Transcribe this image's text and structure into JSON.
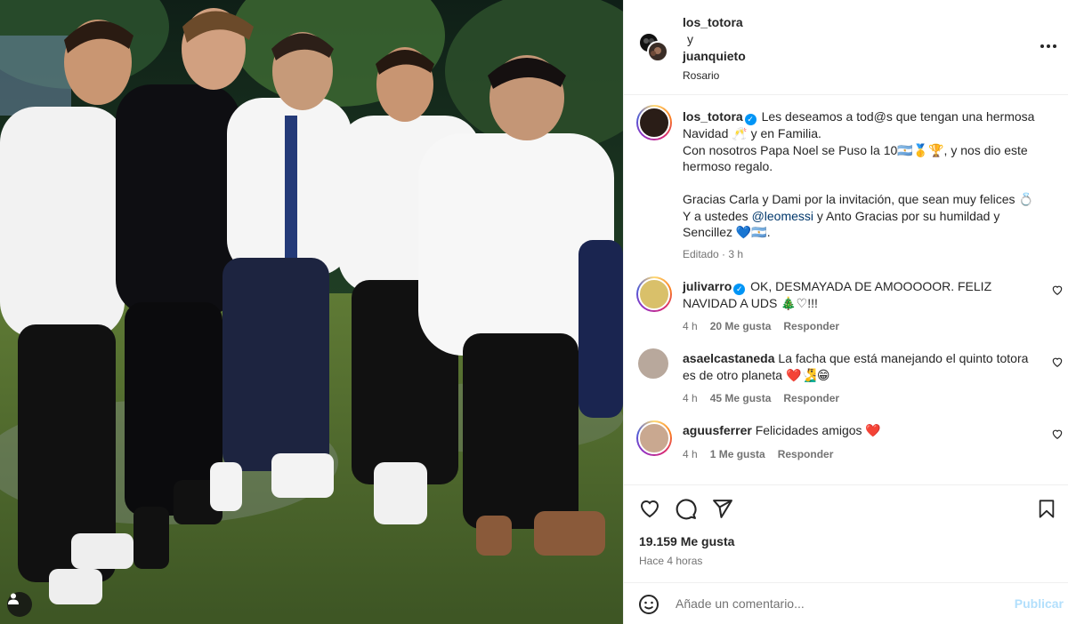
{
  "post": {
    "authors": [
      "los_totora",
      "juanquieto"
    ],
    "joiner": "y",
    "location": "Rosario",
    "caption": {
      "username": "los_totora",
      "line1": "Les deseamos a tod@s que tengan una hermosa Navidad 🥂 y en Familia.",
      "line2": "Con nosotros Papa Noel se Puso la 10🇦🇷🥇🏆, y nos dio este hermoso regalo.",
      "line3_a": "Gracias Carla y Dami por la invitación, que sean muy felices 💍 Y a ustedes",
      "mention": "@leomessi",
      "line3_b": "y Anto Gracias por su humildad y Sencillez 💙🇦🇷.",
      "edited": "Editado · 3 h"
    },
    "likes": "19.159 Me gusta",
    "time_ago": "Hace 4 horas"
  },
  "comments": [
    {
      "username": "julivarro",
      "verified": true,
      "text": "OK, DESMAYADA DE AMOOOOOR. FELIZ NAVIDAD A UDS 🎄♡!!!",
      "time": "4 h",
      "likes": "20 Me gusta",
      "reply": "Responder"
    },
    {
      "username": "asaelcastaneda",
      "verified": false,
      "text": "La facha que está manejando el quinto totora es de otro planeta ❤️🧏‍♂️😁",
      "time": "4 h",
      "likes": "45 Me gusta",
      "reply": "Responder"
    },
    {
      "username": "aguusferrer",
      "verified": false,
      "text": "Felicidades amigos ❤️",
      "time": "4 h",
      "likes": "1 Me gusta",
      "reply": "Responder"
    }
  ],
  "composer": {
    "placeholder": "Añade un comentario...",
    "publish": "Publicar"
  },
  "icons": {
    "like": "heart-icon",
    "comment": "comment-icon",
    "share": "share-icon",
    "save": "bookmark-icon",
    "emoji": "emoji-icon",
    "more": "more-options-icon",
    "tag": "user-tag-icon"
  },
  "colors": {
    "link": "#00376b",
    "verified": "#0095f6",
    "publish_disabled": "#b2dffc",
    "secondary_text": "#737373"
  }
}
